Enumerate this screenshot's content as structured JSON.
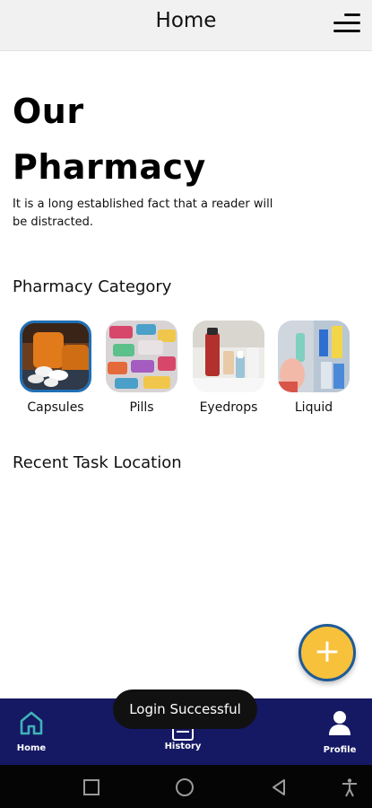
{
  "header": {
    "title": "Home"
  },
  "hero": {
    "line1": "Our",
    "line2": "Pharmacy",
    "description": "It is a long established fact that a reader will be distracted."
  },
  "category_section": {
    "title": "Pharmacy Category",
    "items": [
      {
        "label": "Capsules",
        "image": "capsules-photo",
        "selected": true
      },
      {
        "label": "Pills",
        "image": "pills-photo",
        "selected": false
      },
      {
        "label": "Eyedrops",
        "image": "eyedrops-photo",
        "selected": false
      },
      {
        "label": "Liquid",
        "image": "liquid-photo",
        "selected": false
      }
    ]
  },
  "recent_section": {
    "title": "Recent Task Location"
  },
  "fab": {
    "label": "+",
    "color": "#f7c13b",
    "border": "#1e5a96"
  },
  "toast": {
    "text": "Login Successful"
  },
  "bottom_nav": {
    "background": "#151863",
    "items": [
      {
        "label": "Home",
        "icon": "home-icon",
        "active": true
      },
      {
        "label": "History",
        "icon": "history-icon",
        "active": false
      },
      {
        "label": "Profile",
        "icon": "profile-icon",
        "active": false
      }
    ]
  },
  "system_nav": {
    "icons": [
      "square-icon",
      "circle-icon",
      "back-triangle-icon",
      "accessibility-icon"
    ]
  }
}
